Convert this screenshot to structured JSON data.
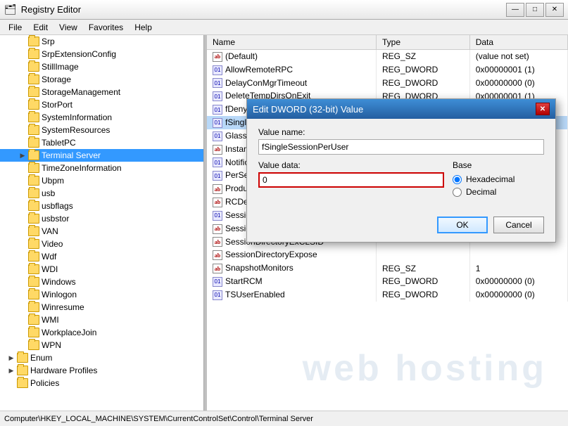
{
  "titleBar": {
    "icon": "🗂",
    "title": "Registry Editor",
    "minBtn": "—",
    "maxBtn": "□",
    "closeBtn": "✕"
  },
  "menuBar": {
    "items": [
      "File",
      "Edit",
      "View",
      "Favorites",
      "Help"
    ]
  },
  "treePane": {
    "items": [
      {
        "id": "srp",
        "label": "Srp",
        "level": 2,
        "hasChildren": false,
        "expanded": false
      },
      {
        "id": "srpext",
        "label": "SrpExtensionConfig",
        "level": 2,
        "hasChildren": false,
        "expanded": false
      },
      {
        "id": "stillimage",
        "label": "StillImage",
        "level": 2,
        "hasChildren": false,
        "expanded": false
      },
      {
        "id": "storage",
        "label": "Storage",
        "level": 2,
        "hasChildren": false,
        "expanded": false
      },
      {
        "id": "storagemgmt",
        "label": "StorageManagement",
        "level": 2,
        "hasChildren": false,
        "expanded": false
      },
      {
        "id": "storport",
        "label": "StorPort",
        "level": 2,
        "hasChildren": false,
        "expanded": false
      },
      {
        "id": "sysinfo",
        "label": "SystemInformation",
        "level": 2,
        "hasChildren": false,
        "expanded": false
      },
      {
        "id": "sysres",
        "label": "SystemResources",
        "level": 2,
        "hasChildren": false,
        "expanded": false
      },
      {
        "id": "tabletpc",
        "label": "TabletPC",
        "level": 2,
        "hasChildren": false,
        "expanded": false
      },
      {
        "id": "termserver",
        "label": "Terminal Server",
        "level": 2,
        "hasChildren": true,
        "expanded": false,
        "selected": true
      },
      {
        "id": "timezone",
        "label": "TimeZoneInformation",
        "level": 2,
        "hasChildren": false,
        "expanded": false
      },
      {
        "id": "ubpm",
        "label": "Ubpm",
        "level": 2,
        "hasChildren": false,
        "expanded": false
      },
      {
        "id": "usb",
        "label": "usb",
        "level": 2,
        "hasChildren": false,
        "expanded": false
      },
      {
        "id": "usbflags",
        "label": "usbflags",
        "level": 2,
        "hasChildren": false,
        "expanded": false
      },
      {
        "id": "usbstor",
        "label": "usbstor",
        "level": 2,
        "hasChildren": false,
        "expanded": false
      },
      {
        "id": "van",
        "label": "VAN",
        "level": 2,
        "hasChildren": false,
        "expanded": false
      },
      {
        "id": "video",
        "label": "Video",
        "level": 2,
        "hasChildren": false,
        "expanded": false
      },
      {
        "id": "wdf",
        "label": "Wdf",
        "level": 2,
        "hasChildren": false,
        "expanded": false
      },
      {
        "id": "wdi",
        "label": "WDI",
        "level": 2,
        "hasChildren": false,
        "expanded": false
      },
      {
        "id": "windows",
        "label": "Windows",
        "level": 2,
        "hasChildren": false,
        "expanded": false
      },
      {
        "id": "winlogon",
        "label": "Winlogon",
        "level": 2,
        "hasChildren": false,
        "expanded": false
      },
      {
        "id": "winresume",
        "label": "Winresume",
        "level": 2,
        "hasChildren": false,
        "expanded": false
      },
      {
        "id": "wmi",
        "label": "WMI",
        "level": 2,
        "hasChildren": false,
        "expanded": false
      },
      {
        "id": "workplacejoin",
        "label": "WorkplaceJoin",
        "level": 2,
        "hasChildren": false,
        "expanded": false
      },
      {
        "id": "wpn",
        "label": "WPN",
        "level": 2,
        "hasChildren": false,
        "expanded": false
      },
      {
        "id": "enum",
        "label": "Enum",
        "level": 1,
        "hasChildren": true,
        "expanded": false
      },
      {
        "id": "hwprofiles",
        "label": "Hardware Profiles",
        "level": 1,
        "hasChildren": true,
        "expanded": false
      },
      {
        "id": "policies",
        "label": "Policies",
        "level": 1,
        "hasChildren": false,
        "expanded": false
      }
    ]
  },
  "valuesPane": {
    "columns": [
      "Name",
      "Type",
      "Data"
    ],
    "rows": [
      {
        "name": "(Default)",
        "type": "REG_SZ",
        "data": "(value not set)",
        "iconType": "ab"
      },
      {
        "name": "AllowRemoteRPC",
        "type": "REG_DWORD",
        "data": "0x00000001 (1)",
        "iconType": "dword"
      },
      {
        "name": "DelayConMgrTimeout",
        "type": "REG_DWORD",
        "data": "0x00000000 (0)",
        "iconType": "dword"
      },
      {
        "name": "DeleteTempDirsOnExit",
        "type": "REG_DWORD",
        "data": "0x00000001 (1)",
        "iconType": "dword"
      },
      {
        "name": "fDenyTSConnections",
        "type": "REG_DWORD",
        "data": "0x00000000 (0)",
        "iconType": "dword"
      },
      {
        "name": "fSingleSessionPerUser",
        "type": "",
        "data": "",
        "iconType": "dword",
        "highlighted": true
      },
      {
        "name": "GlassSessionId",
        "type": "",
        "data": "",
        "iconType": "dword"
      },
      {
        "name": "InstanceID",
        "type": "",
        "data": "",
        "iconType": "ab"
      },
      {
        "name": "NotificationTimeOut",
        "type": "",
        "data": "",
        "iconType": "dword"
      },
      {
        "name": "PerSessionTempDir",
        "type": "",
        "data": "",
        "iconType": "dword"
      },
      {
        "name": "ProductVersion",
        "type": "",
        "data": "",
        "iconType": "ab"
      },
      {
        "name": "RCDependentServices",
        "type": "",
        "data": "",
        "iconType": "ab"
      },
      {
        "name": "SessionDirectoryActive",
        "type": "",
        "data": "",
        "iconType": "dword"
      },
      {
        "name": "SessionDirectoryCLSID",
        "type": "",
        "data": "",
        "iconType": "ab"
      },
      {
        "name": "SessionDirectoryExCLSID",
        "type": "",
        "data": "",
        "iconType": "ab"
      },
      {
        "name": "SessionDirectoryExpose",
        "type": "",
        "data": "",
        "iconType": "ab"
      },
      {
        "name": "SnapshotMonitors",
        "type": "REG_SZ",
        "data": "1",
        "iconType": "ab"
      },
      {
        "name": "StartRCM",
        "type": "REG_DWORD",
        "data": "0x00000000 (0)",
        "iconType": "dword"
      },
      {
        "name": "TSUserEnabled",
        "type": "REG_DWORD",
        "data": "0x00000000 (0)",
        "iconType": "dword"
      }
    ]
  },
  "modal": {
    "title": "Edit DWORD (32-bit) Value",
    "closeBtn": "✕",
    "valueNameLabel": "Value name:",
    "valueNameValue": "fSingleSessionPerUser",
    "valueDataLabel": "Value data:",
    "valueDataValue": "0",
    "baseLabel": "Base",
    "baseOptions": [
      {
        "label": "Hexadecimal",
        "value": "hex",
        "selected": true
      },
      {
        "label": "Decimal",
        "value": "dec",
        "selected": false
      }
    ],
    "okLabel": "OK",
    "cancelLabel": "Cancel"
  },
  "statusBar": {
    "path": "Computer\\HKEY_LOCAL_MACHINE\\SYSTEM\\CurrentControlSet\\Control\\Terminal Server"
  },
  "watermark": {
    "text": "web hosting"
  }
}
